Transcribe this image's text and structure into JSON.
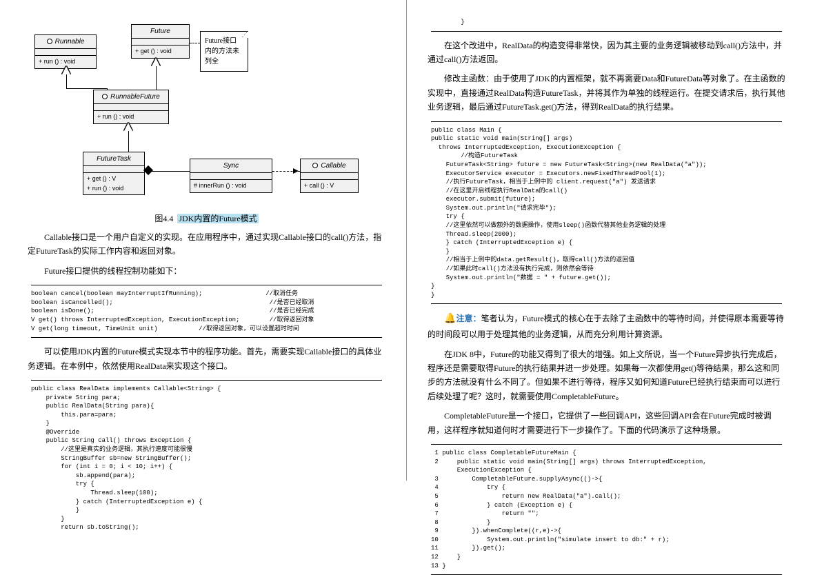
{
  "uml": {
    "runnable_title": "Runnable",
    "runnable_op": "+ run () : void",
    "future_title": "Future",
    "future_op": "+ get () : void",
    "note_text": "Future接口内的方法未列全",
    "runnablefuture_title": "RunnableFuture",
    "runnablefuture_op": "+ run () : void",
    "futuretask_title": "FutureTask",
    "futuretask_op1": "+ get () : V",
    "futuretask_op2": "+ run () : void",
    "sync_title": "Sync",
    "sync_op": "# innerRun () : void",
    "callable_title": "Callable",
    "callable_op": "+ call () : V"
  },
  "fig": {
    "num": "图4.4",
    "title": "JDK内置的Future模式"
  },
  "left": {
    "p1": "Callable接口是一个用户自定义的实现。在应用程序中，通过实现Callable接口的call()方法，指定FutureTask的实际工作内容和返回对象。",
    "p2": "Future接口提供的线程控制功能如下：",
    "code1": "boolean cancel(boolean mayInterruptIfRunning);                 //取消任务\nboolean isCancelled();                                          //是否已经取消\nboolean isDone();                                               //是否已经完成\nV get() throws InterruptedException, ExecutionException;        //取得返回对象\nV get(long timeout, TimeUnit unit)           //取得返回对象，可以设置超时时间",
    "p3": "可以使用JDK内置的Future模式实现本节中的程序功能。首先，需要实现Callable接口的具体业务逻辑。在本例中，依然使用RealData来实现这个接口。",
    "code2": "public class RealData implements Callable<String> {\n    private String para;\n    public RealData(String para){\n        this.para=para;\n    }\n    @Override\n    public String call() throws Exception {\n        //这里是真实的业务逻辑，其执行速度可能很慢\n        StringBuffer sb=new StringBuffer();\n        for (int i = 0; i < 10; i++) {\n            sb.append(para);\n            try {\n                Thread.sleep(100);\n            } catch (InterruptedException e) {\n            }\n        }\n        return sb.toString();"
  },
  "right": {
    "code0_tail": "        }",
    "p1": "在这个改进中，RealData的构造变得非常快，因为其主要的业务逻辑被移动到call()方法中，并通过call()方法返回。",
    "p2": "修改主函数：由于使用了JDK的内置框架，就不再需要Data和FutureData等对象了。在主函数的实现中，直接通过RealData构造FutureTask，并将其作为单独的线程运行。在提交请求后，执行其他业务逻辑，最后通过FutureTask.get()方法，得到RealData的执行结果。",
    "code1": "public class Main {\npublic static void main(String[] args)\n  throws InterruptedException, ExecutionException {\n        //构造FutureTask\n    FutureTask<String> future = new FutureTask<String>(new RealData(\"a\"));\n    ExecutorService executor = Executors.newFixedThreadPool(1);\n    //执行FutureTask，相当于上例中的 client.request(\"a\") 发送请求\n    //在这里开启线程执行RealData的call()\n    executor.submit(future);\n    System.out.println(\"请求完毕\");\n    try {\n    //这里依然可以做额外的数据操作，使用sleep()函数代替其他业务逻辑的处理\n    Thread.sleep(2000);\n    } catch (InterruptedException e) {\n    }\n    //相当于上例中的data.getResult()，取得call()方法的返回值\n    //如果此时call()方法没有执行完成，则依然会等待\n    System.out.println(\"数据 = \" + future.get());\n}\n}",
    "note_label": "注意：",
    "note_text": "笔者认为，Future模式的核心在于去除了主函数中的等待时间，并使得原本需要等待的时间段可以用于处理其他的业务逻辑，从而充分利用计算资源。",
    "p3": "在JDK 8中，Future的功能又得到了很大的增强。如上文所说，当一个Future异步执行完成后，程序还是需要取得Future的执行结果并进一步处理。如果每一次都使用get()等待结果，那么这和同步的方法就没有什么不同了。但如果不进行等待，程序又如何知道Future已经执行结束而可以进行后续处理了呢？这时，就需要使用CompletableFuture。",
    "p4": "CompletableFuture是一个接口，它提供了一些回调API，这些回调API会在Future完成时被调用，这样程序就知道何时才需要进行下一步操作了。下面的代码演示了这种场景。",
    "code2": " 1 public class CompletableFutureMain {\n 2     public static void main(String[] args) throws InterruptedException,\n       ExecutionException {\n 3         CompletableFuture.supplyAsync(()->{\n 4             try {\n 5                 return new RealData(\"a\").call();\n 6             } catch (Exception e) {\n 7                 return \"\";\n 8             }\n 9         }).whenComplete((r,e)->{\n10             System.out.println(\"simulate insert to db:\" + r);\n11         }).get();\n12     }\n13 }"
  }
}
